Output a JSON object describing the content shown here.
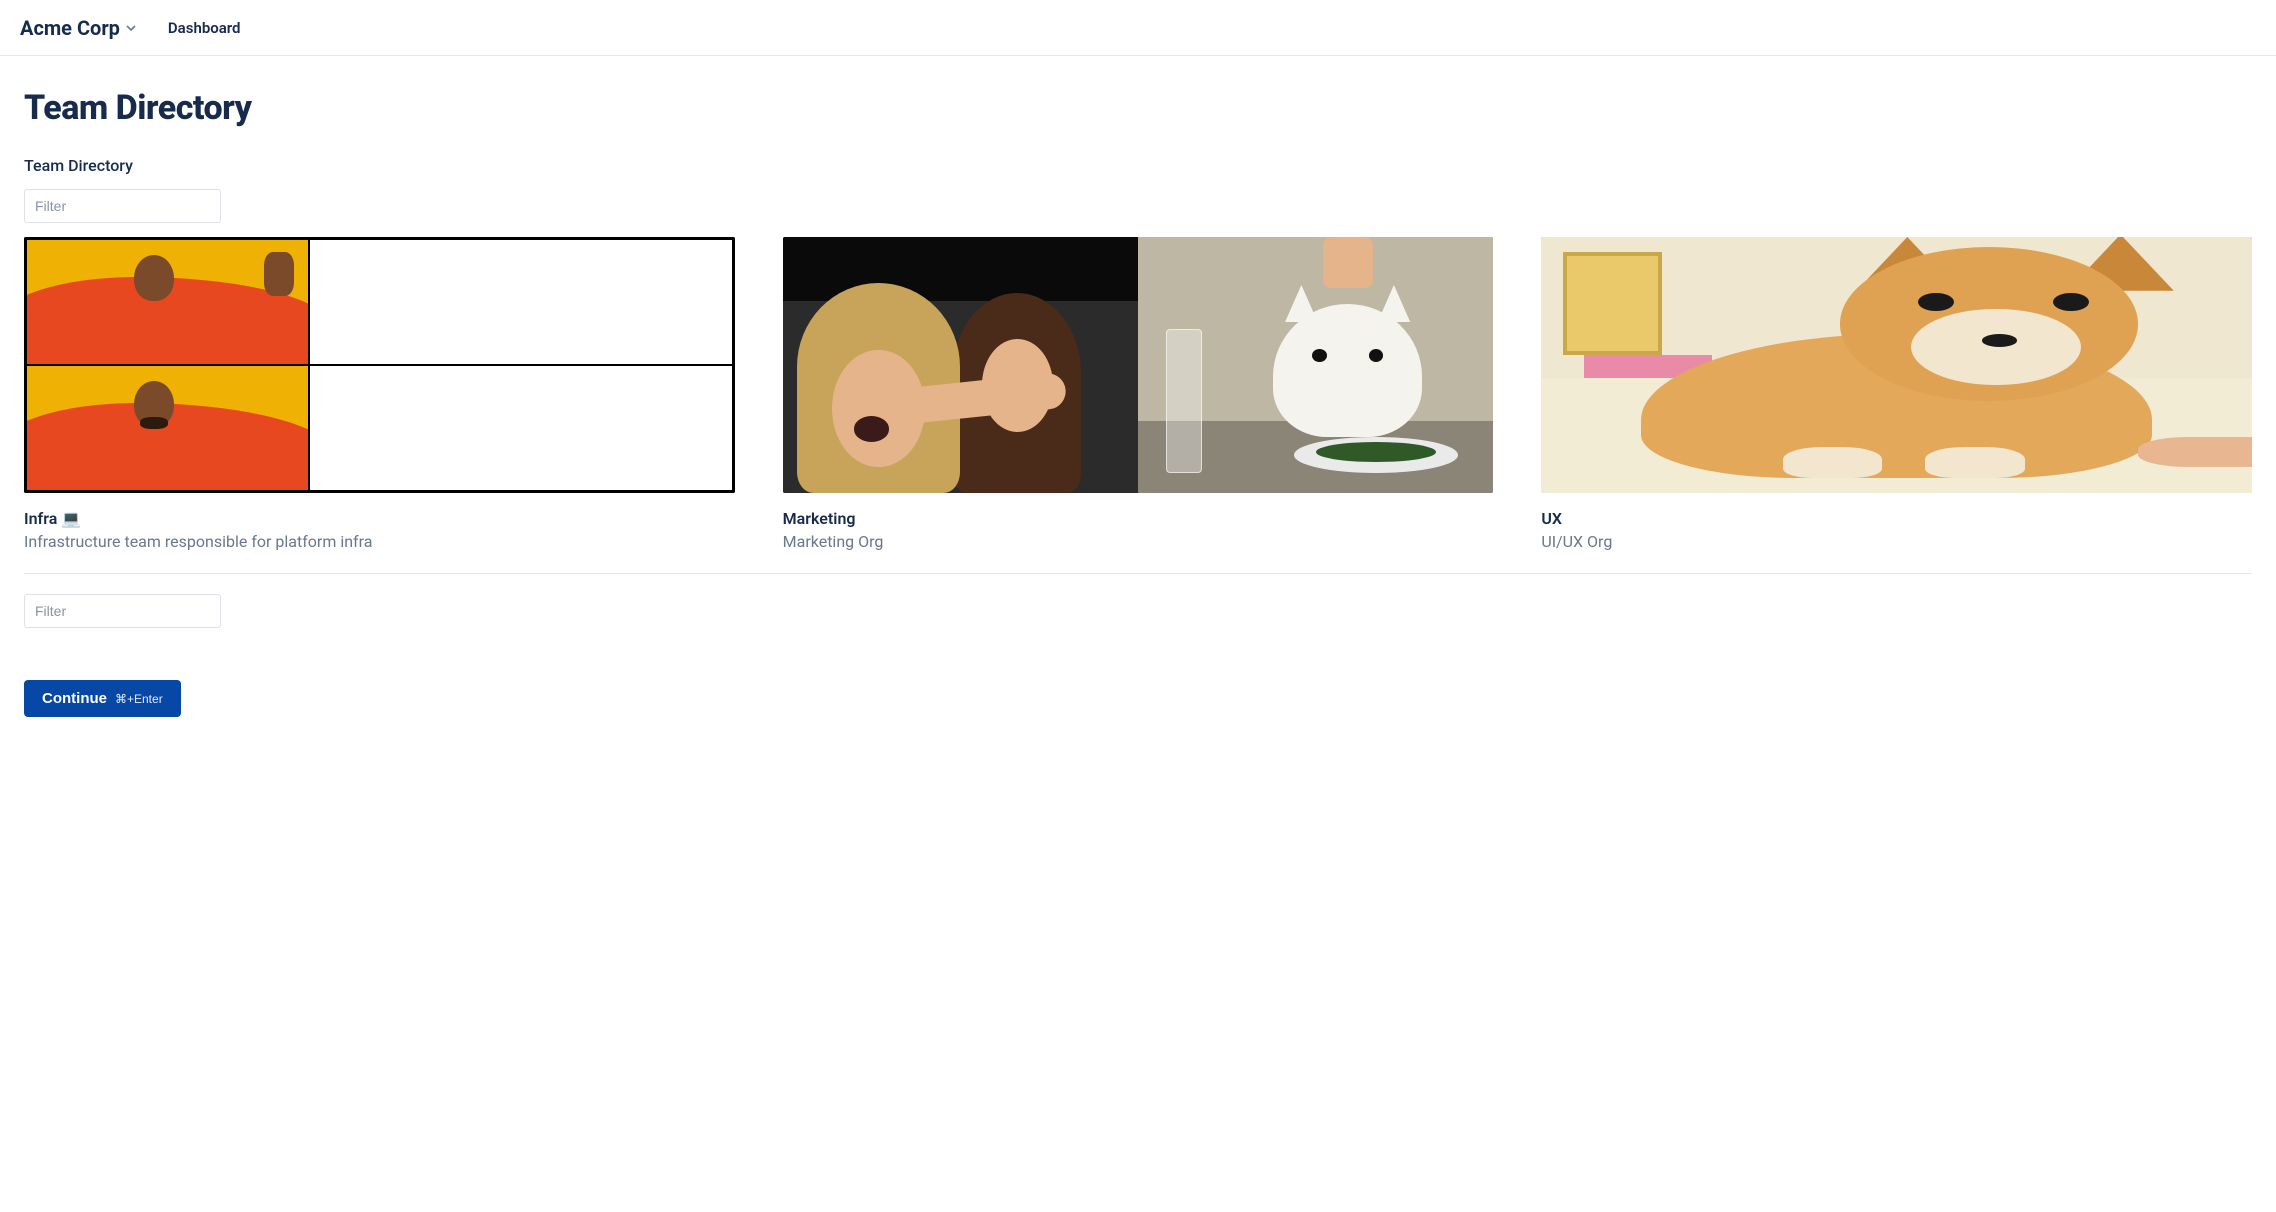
{
  "navbar": {
    "brand": "Acme Corp",
    "items": [
      {
        "label": "Dashboard"
      }
    ]
  },
  "page": {
    "title": "Team Directory",
    "section_label": "Team Directory"
  },
  "filters": {
    "top_placeholder": "Filter",
    "bottom_placeholder": "Filter"
  },
  "teams": [
    {
      "title": "Infra 💻",
      "subtitle": "Infrastructure team responsible for platform infra",
      "image": "drake-meme"
    },
    {
      "title": "Marketing",
      "subtitle": "Marketing Org",
      "image": "woman-yelling-at-cat-meme"
    },
    {
      "title": "UX",
      "subtitle": "UI/UX Org",
      "image": "doge-meme"
    }
  ],
  "actions": {
    "continue": {
      "label": "Continue",
      "shortcut": "⌘+Enter"
    }
  }
}
